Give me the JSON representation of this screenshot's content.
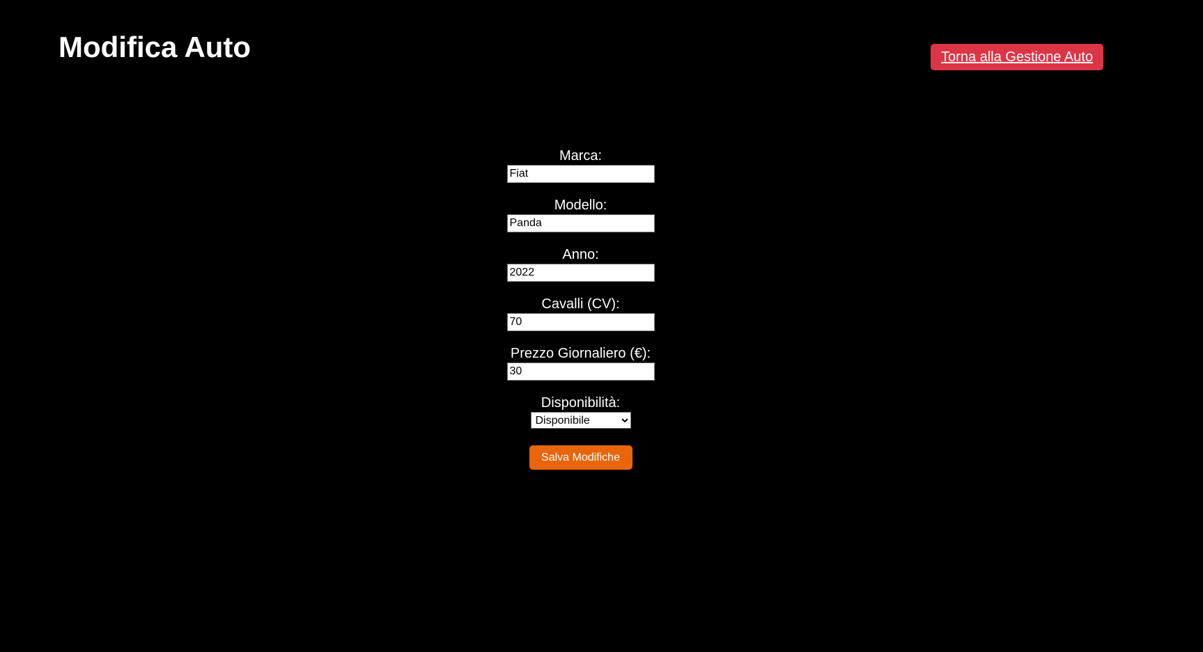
{
  "header": {
    "title": "Modifica Auto",
    "back_link_label": "Torna alla Gestione Auto",
    "back_link_color": "#dc3545"
  },
  "form": {
    "fields": [
      {
        "label": "Marca:",
        "value": "Fiat"
      },
      {
        "label": "Modello:",
        "value": "Panda"
      },
      {
        "label": "Anno:",
        "value": "2022"
      },
      {
        "label": "Cavalli (CV):",
        "value": "70"
      },
      {
        "label": "Prezzo Giornaliero (€):",
        "value": "30"
      }
    ],
    "availability": {
      "label": "Disponibilità:",
      "selected": "Disponibile"
    },
    "save_label": "Salva Modifiche",
    "save_color": "#e8650a"
  }
}
